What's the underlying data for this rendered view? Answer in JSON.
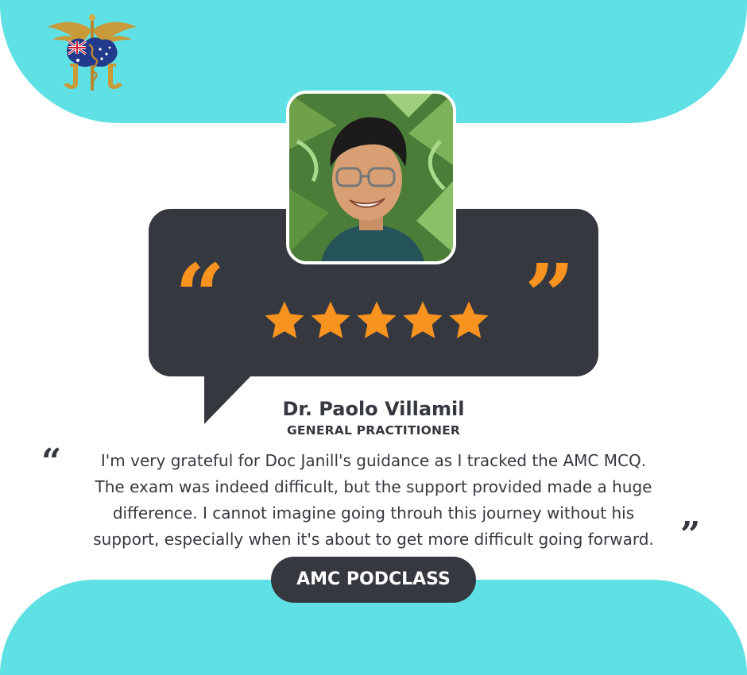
{
  "testimonial": {
    "name": "Dr. Paolo Villamil",
    "role": "GENERAL PRACTITIONER",
    "quote_lines": [
      "I'm very grateful for Doc Janill's guidance as I tracked the AMC MCQ.",
      "The exam was indeed difficult, but the support provided made a huge",
      "difference. I cannot imagine going throuh this journey without his",
      "support, especially when it's about to get more difficult going forward."
    ],
    "rating": 5,
    "open_quote": "“",
    "close_quote": "”"
  },
  "footer": {
    "badge_label": "AMC PODCLASS"
  },
  "colors": {
    "accent": "#f7931e",
    "dark": "#363840",
    "band": "#5ee0e4"
  },
  "icons": [
    "logo-icon",
    "star-icon",
    "quote-icon"
  ]
}
